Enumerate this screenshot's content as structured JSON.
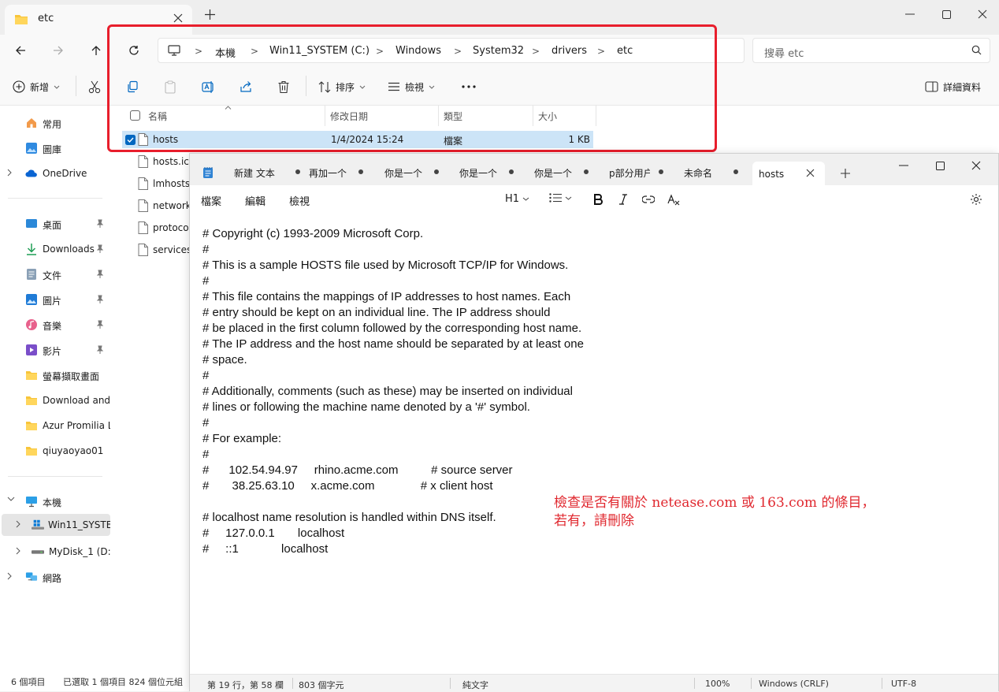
{
  "explorer": {
    "tab_title": "etc",
    "breadcrumb": [
      "本機",
      "Win11_SYSTEM (C:)",
      "Windows",
      "System32",
      "drivers",
      "etc"
    ],
    "search_placeholder": "搜尋 etc",
    "toolbar": {
      "new_label": "新增",
      "sort_label": "排序",
      "view_label": "檢視",
      "details_label": "詳細資料"
    },
    "columns": [
      "名稱",
      "修改日期",
      "類型",
      "大小"
    ],
    "selected_row": {
      "name": "hosts",
      "date": "1/4/2024 15:24",
      "type": "檔案",
      "size": "1 KB"
    },
    "files": [
      "hosts.ics",
      "lmhosts.",
      "network",
      "protoco",
      "services"
    ],
    "sidebar": {
      "quick": [
        {
          "label": "常用",
          "icon": "home-icon"
        },
        {
          "label": "圖庫",
          "icon": "gallery-icon"
        }
      ],
      "onedrive": "OneDrive",
      "pinned": [
        {
          "label": "桌面",
          "icon": "desktop-icon"
        },
        {
          "label": "Downloads",
          "icon": "download-icon"
        },
        {
          "label": "文件",
          "icon": "document-icon"
        },
        {
          "label": "圖片",
          "icon": "picture-icon"
        },
        {
          "label": "音樂",
          "icon": "music-icon"
        },
        {
          "label": "影片",
          "icon": "video-icon"
        },
        {
          "label": "螢幕擷取畫面",
          "icon": "folder-icon"
        },
        {
          "label": "Download and",
          "icon": "folder-icon"
        },
        {
          "label": "Azur Promilia L",
          "icon": "folder-icon"
        },
        {
          "label": "qiuyaoyao01",
          "icon": "folder-icon"
        }
      ],
      "this_pc": "本機",
      "drives": [
        "Win11_SYSTE",
        "MyDisk_1 (D:)"
      ],
      "network": "網路"
    },
    "status": {
      "items": "6 個項目",
      "selected": "已選取 1 個項目 824 個位元組"
    }
  },
  "notepad": {
    "tabs": [
      "新建 文本",
      "再加一个",
      "你是一个",
      "你是一个",
      "你是一个",
      "p部分用户",
      "未命名"
    ],
    "active_tab": "hosts",
    "menu": [
      "檔案",
      "編輯",
      "檢視"
    ],
    "heading_label": "H1",
    "lines": [
      "# Copyright (c) 1993-2009 Microsoft Corp.",
      "#",
      "# This is a sample HOSTS file used by Microsoft TCP/IP for Windows.",
      "#",
      "# This file contains the mappings of IP addresses to host names. Each",
      "# entry should be kept on an individual line. The IP address should",
      "# be placed in the first column followed by the corresponding host name.",
      "# The IP address and the host name should be separated by at least one",
      "# space.",
      "#",
      "# Additionally, comments (such as these) may be inserted on individual",
      "# lines or following the machine name denoted by a '#' symbol.",
      "#",
      "# For example:",
      "#",
      "#      102.54.94.97     rhino.acme.com          # source server",
      "#       38.25.63.10     x.acme.com              # x client host",
      "",
      "# localhost name resolution is handled within DNS itself.",
      "#     127.0.0.1       localhost",
      "#     ::1             localhost"
    ],
    "annotation": [
      "檢查是否有關於 netease.com 或 163.com 的條目，",
      "若有，請刪除"
    ],
    "status": {
      "position": "第 19 行，第 58 欄",
      "chars": "803 個字元",
      "format": "純文字",
      "zoom": "100%",
      "eol": "Windows (CRLF)",
      "encoding": "UTF-8"
    }
  },
  "colors": {
    "highlight_box": "#e81e2c",
    "selection": "#cce4f7",
    "annotation": "#e0282f",
    "accent": "#0067c0"
  }
}
